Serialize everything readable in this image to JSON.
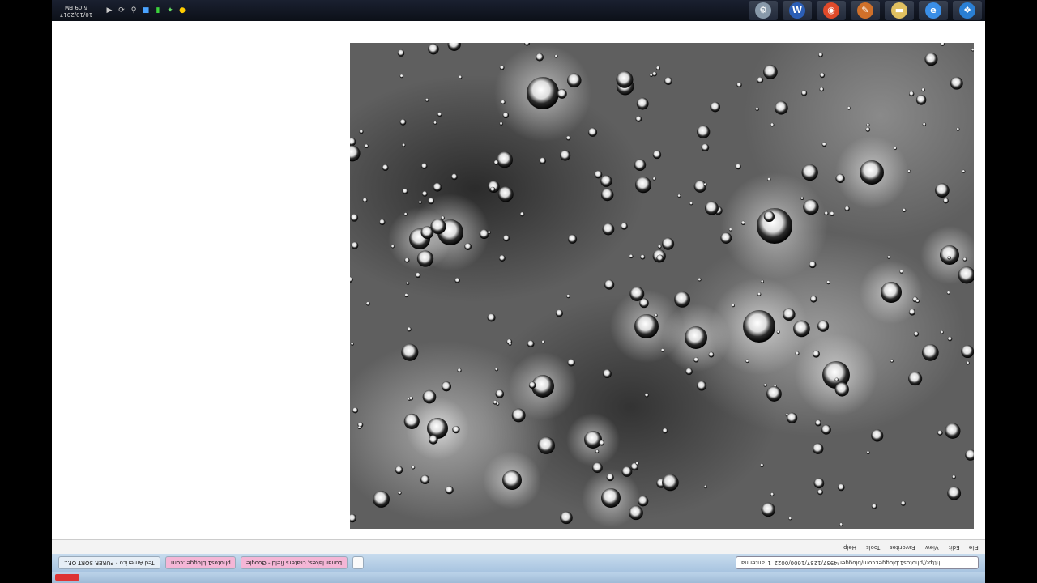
{
  "taskbar": {
    "clock": {
      "time": "6:09 PM",
      "date": "10/10/2017"
    },
    "tray_icons": [
      {
        "name": "play-icon",
        "glyph": "▶",
        "color": "#cccccc"
      },
      {
        "name": "refresh-icon",
        "glyph": "⟳",
        "color": "#cccccc"
      },
      {
        "name": "search-icon",
        "glyph": "⚲",
        "color": "#cccccc"
      },
      {
        "name": "monitor-icon",
        "glyph": "■",
        "color": "#4aa3ff"
      },
      {
        "name": "battery-icon",
        "glyph": "▮",
        "color": "#3cd33c"
      },
      {
        "name": "network-icon",
        "glyph": "✦",
        "color": "#66dd66"
      },
      {
        "name": "shield-icon",
        "glyph": "●",
        "color": "#ffcc00"
      }
    ],
    "pinned": [
      {
        "name": "settings-app-icon",
        "glyph": "⚙",
        "color": "#8899aa"
      },
      {
        "name": "word-app-icon",
        "glyph": "W",
        "color": "#2b5eb6"
      },
      {
        "name": "chrome-app-icon",
        "glyph": "◉",
        "color": "#e04a2a"
      },
      {
        "name": "paint-app-icon",
        "glyph": "✎",
        "color": "#d0702a"
      },
      {
        "name": "folder-app-icon",
        "glyph": "▬",
        "color": "#e0c060"
      },
      {
        "name": "ie-app-icon",
        "glyph": "e",
        "color": "#3a8ee6"
      },
      {
        "name": "start-orb-icon",
        "glyph": "❖",
        "color": "#2a7fd4"
      }
    ]
  },
  "image": {
    "alt": ""
  },
  "menu": [
    "File",
    "Edit",
    "View",
    "Favorites",
    "Tools",
    "Help"
  ],
  "tabs": [
    {
      "label": "Ted Americo - PURER SORT OF...",
      "style": "normal"
    },
    {
      "label": "photos1.blogger.com",
      "style": "pink"
    },
    {
      "label": "Lunar lakes, craters field - Google",
      "style": "pink"
    },
    {
      "label": "",
      "style": "active"
    }
  ],
  "address": {
    "value": "http://photos1.blogger.com/blogger/4937/1237/1600/0022_1_antenna"
  },
  "window": {
    "title": ""
  }
}
